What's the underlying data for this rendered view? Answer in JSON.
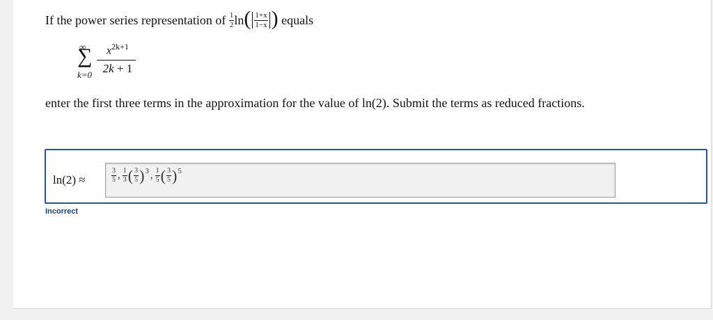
{
  "question": {
    "prefix": "If the power series representation of",
    "half_num": "1",
    "half_den": "2",
    "ln": "ln",
    "inner_num": "1+x",
    "inner_den": "1−x",
    "suffix": "equals"
  },
  "series": {
    "upper": "∞",
    "sigma": "∑",
    "lower": "k=0",
    "num_base": "x",
    "num_exp": "2k+1",
    "den_var": "2k",
    "den_rest": " + 1"
  },
  "instruction": "enter the first three terms in the approximation for the value of ln(2). Submit the terms as reduced fractions.",
  "answer": {
    "label": "ln(2) ≈",
    "input": {
      "t1_num": "3",
      "t1_den": "5",
      "t2_coef_num": "1",
      "t2_coef_den": "3",
      "t2_inner_num": "3",
      "t2_inner_den": "5",
      "t2_exp": "3",
      "t3_coef_num": "1",
      "t3_coef_den": "5",
      "t3_inner_num": "3",
      "t3_inner_den": "5",
      "t3_exp": "5",
      "comma": ","
    }
  },
  "status": "Incorrect",
  "colors": {
    "accent": "#2f4f9c",
    "status": "#1c3c8c",
    "page_bg": "#f1f1f1"
  }
}
